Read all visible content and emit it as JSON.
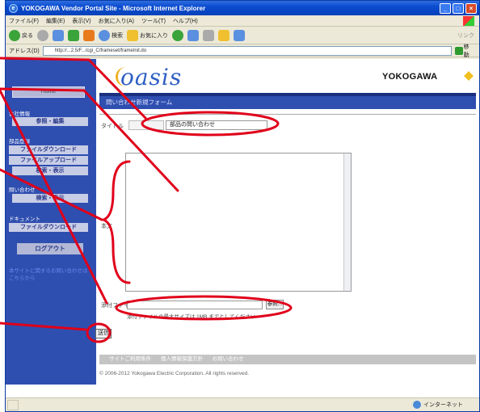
{
  "window": {
    "title": "YOKOGAWA Vendor Portal Site - Microsoft Internet Explorer",
    "menu": [
      "ファイル(F)",
      "編集(E)",
      "表示(V)",
      "お気に入り(A)",
      "ツール(T)",
      "ヘルプ(H)"
    ],
    "toolbar": {
      "back": "戻る",
      "search": "検索",
      "favorites": "お気に入り",
      "links": "リンク"
    },
    "address_label": "アドレス(D)",
    "address_value": "http://...2.5/F.../cgi_C/frameset/frameInit.do",
    "go_label": "移動",
    "status_zone": "インターネット"
  },
  "sidebar": {
    "home": "Home",
    "company_label": "会社情報",
    "company_btn": "参照・編集",
    "parts_label": "部品登録",
    "parts_download": "ファイルダウンロード",
    "parts_upload": "ファイルアップロード",
    "parts_search": "検索・表示",
    "inquiry_label": "問い合わせ",
    "inquiry_search": "検索・表示",
    "docs_label": "ドキュメント",
    "docs_download": "ファイルダウンロード",
    "logout": "ログアウト",
    "note": "本サイトに関するお問い合わせはこちらから"
  },
  "header": {
    "logo": "oasis",
    "brand": "YOKOGAWA",
    "form_title": "問い合わせ新規フォーム"
  },
  "form": {
    "title_label": "タイトル",
    "title_value": "部品の問い合わせ",
    "body_label": "本文",
    "file_label": "添付ファイル",
    "browse": "参照...",
    "file_note": "添付ファイルの最大サイズは 1MB までとしてください",
    "send": "送信"
  },
  "footer": {
    "links": [
      "サイトご利用条件",
      "個人情報保護方針",
      "お問い合わせ"
    ],
    "copyright": "© 2006-2012 Yokogawa Electric Corporation. All rights reserved."
  },
  "colors": {
    "sidebar": "#2f4fb0",
    "annotation": "#e0001a",
    "accent": "#f0c020"
  }
}
